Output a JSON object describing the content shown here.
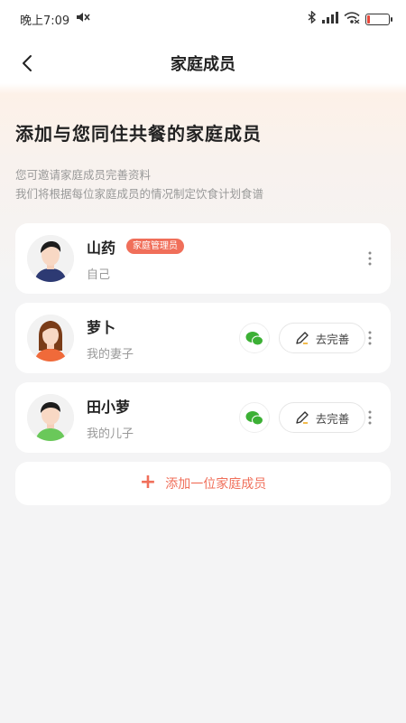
{
  "status_bar": {
    "time": "晚上7:09",
    "icons": [
      "mute-icon",
      "bluetooth-icon",
      "signal-icon",
      "wifi-icon",
      "battery-icon"
    ],
    "battery_level": 0.15
  },
  "nav": {
    "title": "家庭成员",
    "back_icon": "chevron-left-icon"
  },
  "intro": {
    "heading": "添加与您同住共餐的家庭成员",
    "line1": "您可邀请家庭成员完善资料",
    "line2": "我们将根据每位家庭成员的情况制定饮食计划食谱"
  },
  "members": [
    {
      "name": "山药",
      "relation": "自己",
      "badge": "家庭管理员",
      "avatar": "man-avatar"
    },
    {
      "name": "萝卜",
      "relation": "我的妻子",
      "action_label": "去完善",
      "avatar": "woman-avatar"
    },
    {
      "name": "田小萝",
      "relation": "我的儿子",
      "action_label": "去完善",
      "avatar": "boy-avatar"
    }
  ],
  "add_member": {
    "label": "添加一位家庭成员"
  },
  "colors": {
    "accent": "#f06f5a",
    "wechat": "#3cb035",
    "text_muted": "#999999"
  }
}
